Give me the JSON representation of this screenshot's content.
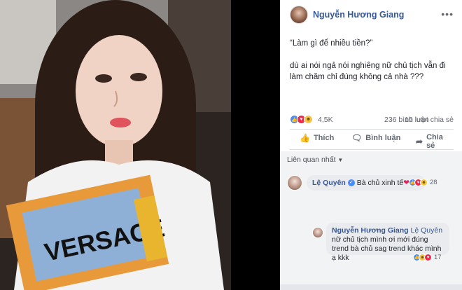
{
  "post": {
    "author": "Nguyễn Hương Giang",
    "text_line1": "“Làm gì để nhiều tiền?”",
    "text_line2": "dù ai nói ngả nói nghiêng nữ chủ tịch vẫn đi làm chăm chỉ đúng không cả nhà ???",
    "more_label": "•••"
  },
  "stats": {
    "reactions": "4,5K",
    "comments": "236 bình luận",
    "shares": "19 lượt chia sẻ"
  },
  "actions": {
    "like": "Thích",
    "comment": "Bình luận",
    "share": "Chia sẻ"
  },
  "comments": {
    "sort_label": "Liên quan nhất",
    "items": [
      {
        "name": "Lệ Quyên",
        "text": "Bà chủ xinh tế",
        "reactions": "28"
      }
    ],
    "reply": {
      "name": "Nguyễn Hương Giang",
      "mention": "Lệ Quyên",
      "text": "nữ chủ tịch mình ơi mới đúng trend bà chủ sag trend khác mình ạ kkk",
      "reactions": "17"
    }
  },
  "photo": {
    "shirt_text": "VERSACE"
  },
  "colors": {
    "link_blue": "#365899",
    "like_blue": "#4b8df8",
    "love_red": "#f0284a",
    "haha_yellow": "#f7c544"
  }
}
